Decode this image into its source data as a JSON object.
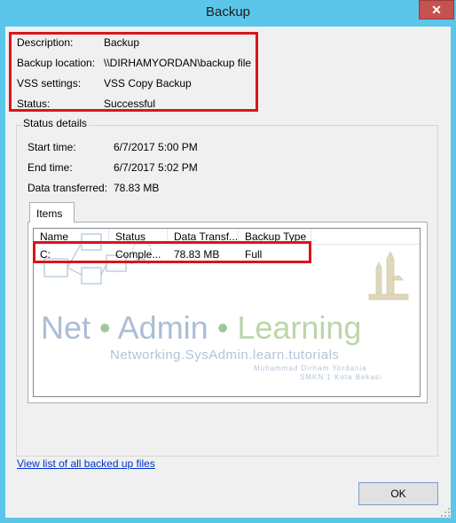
{
  "window": {
    "title": "Backup"
  },
  "summary": {
    "description_label": "Description:",
    "description_value": "Backup",
    "location_label": "Backup location:",
    "location_value": "\\\\DIRHAMYORDAN\\backup file",
    "vss_label": "VSS settings:",
    "vss_value": "VSS Copy Backup",
    "status_label": "Status:",
    "status_value": "Successful"
  },
  "status_details": {
    "legend": "Status details",
    "start_label": "Start time:",
    "start_value": "6/7/2017 5:00 PM",
    "end_label": "End time:",
    "end_value": "6/7/2017 5:02 PM",
    "transferred_label": "Data transferred:",
    "transferred_value": "78.83 MB"
  },
  "items_tab": {
    "label": "Items",
    "columns": [
      "Name",
      "Status",
      "Data Transf...",
      "Backup Type"
    ],
    "rows": [
      {
        "name": "C:",
        "status": "Comple...",
        "data": "78.83 MB",
        "type": "Full"
      }
    ]
  },
  "watermark": {
    "title_part1": "Net",
    "title_part2": "Admin",
    "title_part3": "Learning",
    "subtitle": "Networking.SysAdmin.learn.tutorials",
    "credit1": "Muhammad Dirham Yordania",
    "credit2": "SMKN 1 Kota Bekasi"
  },
  "footer": {
    "link": "View list of all backed up files",
    "ok": "OK"
  },
  "colors": {
    "titlebar": "#5cc6ea",
    "highlight": "#d8161b",
    "link": "#0033cc"
  }
}
